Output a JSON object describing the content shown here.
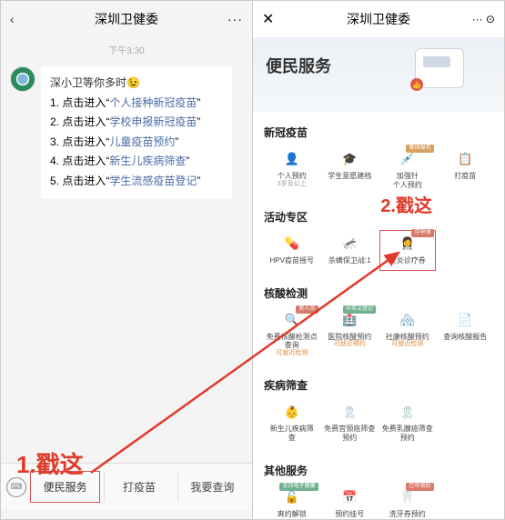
{
  "left": {
    "header_title": "深圳卫健委",
    "timestamp": "下午3:30",
    "greeting": "深小卫等你多时",
    "emoji": "😉",
    "items": [
      {
        "prefix": "1. 点击进入“",
        "link": "个人接种新冠疫苗",
        "suffix": "”"
      },
      {
        "prefix": "2. 点击进入“",
        "link": "学校申报新冠疫苗",
        "suffix": "”"
      },
      {
        "prefix": "3. 点击进入“",
        "link": "儿童疫苗预约",
        "suffix": "”"
      },
      {
        "prefix": "4. 点击进入“",
        "link": "新生儿疾病筛查",
        "suffix": "”"
      },
      {
        "prefix": "5. 点击进入“",
        "link": "学生流感疫苗登记",
        "suffix": "”"
      }
    ],
    "bottom": [
      "便民服务",
      "打疫苗",
      "我要查询"
    ]
  },
  "right": {
    "header_title": "深圳卫健委",
    "banner_title": "便民服务",
    "sections": [
      {
        "title": "新冠疫苗",
        "tiles": [
          {
            "label": "个人预约",
            "sub": "3岁及以上",
            "icon": "👤",
            "css": "c-teal"
          },
          {
            "label": "学生意愿建档",
            "icon": "🎓",
            "css": "c-blue"
          },
          {
            "label": "加强针\n个人预约",
            "icon": "💉",
            "css": "c-teal",
            "badge": "集体报名",
            "badgeCss": ""
          },
          {
            "label": "打疫苗",
            "icon": "📋",
            "css": "c-blue"
          }
        ]
      },
      {
        "title": "活动专区",
        "tiles": [
          {
            "label": "HPV疫苗摇号",
            "icon": "💊",
            "css": "c-teal"
          },
          {
            "label": "杀螨保卫战:1",
            "icon": "🦟",
            "css": "c-orange2"
          },
          {
            "label": "皮炎诊疗券",
            "icon": "👩‍⚕️",
            "css": "c-teal",
            "badge": "可申领",
            "badgeCss": "red-b",
            "hl": true
          }
        ]
      },
      {
        "title": "核酸检测",
        "tiles": [
          {
            "label": "免费核酸检测点\n查询",
            "sub": "可就近检测",
            "subCss": "orange",
            "icon": "🔍",
            "css": "c-teal",
            "badge": "新人员",
            "badgeCss": "red-b"
          },
          {
            "label": "医院核酸预约",
            "sub": "可就近预约",
            "subCss": "orange",
            "icon": "🏥",
            "css": "c-teal",
            "badge": "中英文登记",
            "badgeCss": "green-b"
          },
          {
            "label": "社康核酸预约",
            "sub": "可就近检测",
            "subCss": "orange",
            "icon": "🏘",
            "css": "c-blue"
          },
          {
            "label": "查询核酸报告",
            "icon": "📄",
            "css": "c-teal"
          }
        ]
      },
      {
        "title": "疾病筛查",
        "tiles": [
          {
            "label": "新生儿疾病筛\n查",
            "icon": "👶",
            "css": "c-orange2"
          },
          {
            "label": "免费宫颈癌筛查\n预约",
            "icon": "🎗",
            "css": "c-blue"
          },
          {
            "label": "免费乳腺癌筛查\n预约",
            "icon": "🎗",
            "css": "c-green"
          }
        ]
      },
      {
        "title": "其他服务",
        "tiles": [
          {
            "label": "爽约解锁",
            "icon": "🔓",
            "css": "c-teal",
            "badge": "支持电子健康",
            "badgeCss": "green-b"
          },
          {
            "label": "预约挂号",
            "icon": "📅",
            "css": "c-blue"
          },
          {
            "label": "洗牙券预约",
            "icon": "🦷",
            "css": "c-teal",
            "badge": "已申领后",
            "badgeCss": "red-b"
          }
        ]
      }
    ]
  },
  "annotations": {
    "step1": "1.戳这",
    "step2": "2.戳这"
  }
}
